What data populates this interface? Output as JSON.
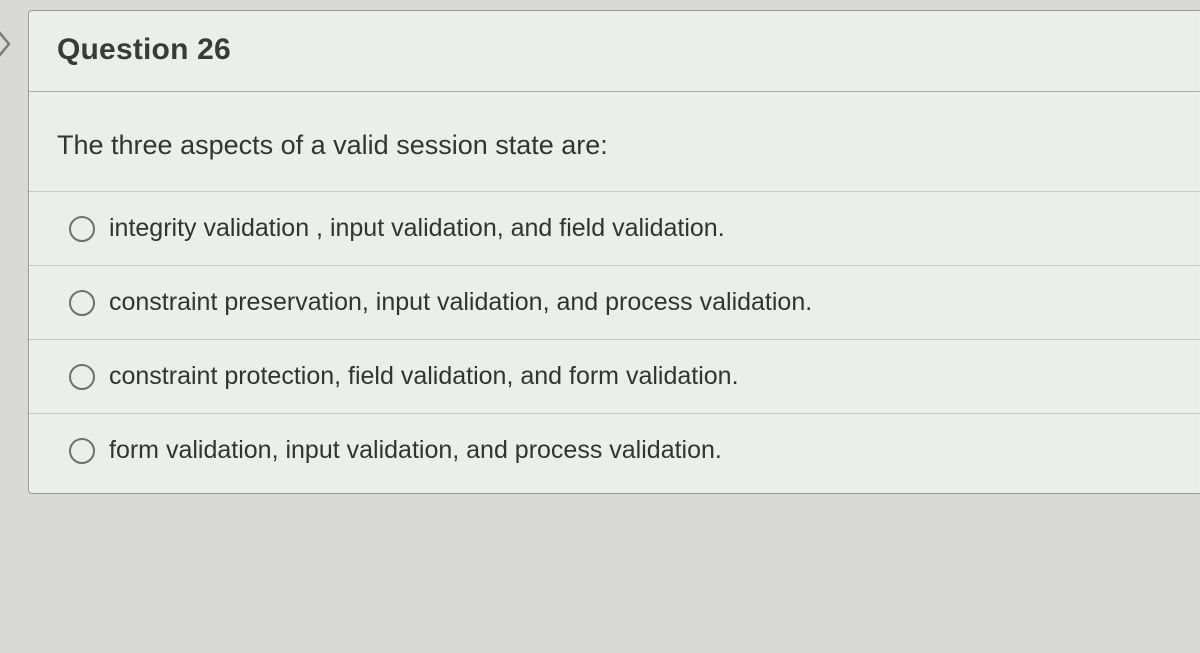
{
  "question": {
    "title": "Question 26",
    "prompt": "The three aspects of a valid session state are:",
    "options": [
      "integrity validation , input validation, and field validation.",
      "constraint preservation, input validation, and process validation.",
      "constraint protection, field validation, and form validation.",
      "form validation, input validation, and process validation."
    ]
  }
}
